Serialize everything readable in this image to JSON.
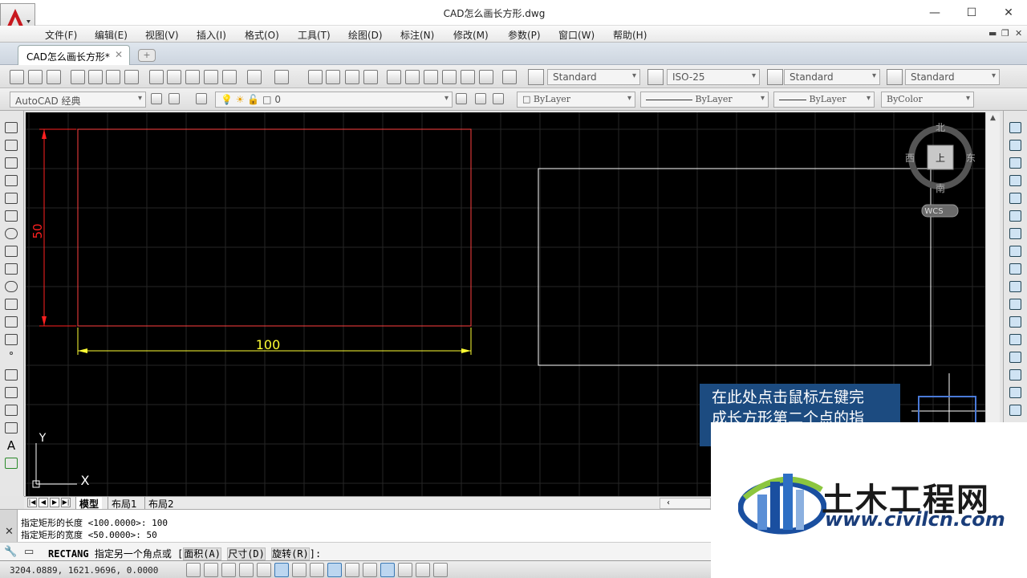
{
  "window": {
    "title": "CAD怎么画长方形.dwg",
    "min_glyph": "—",
    "max_glyph": "☐",
    "close_glyph": "✕"
  },
  "menu": {
    "items": [
      "文件(F)",
      "编辑(E)",
      "视图(V)",
      "插入(I)",
      "格式(O)",
      "工具(T)",
      "绘图(D)",
      "标注(N)",
      "修改(M)",
      "参数(P)",
      "窗口(W)",
      "帮助(H)"
    ]
  },
  "tab": {
    "label": "CAD怎么画长方形*",
    "close": "✕",
    "new": "+"
  },
  "styles": {
    "text_style": "Standard",
    "dim_style": "ISO-25",
    "table_style": "Standard",
    "mleader_style": "Standard"
  },
  "toolbar2": {
    "workspace": "AutoCAD 经典",
    "layer": "0",
    "color": "ByLayer",
    "linetype": "ByLayer",
    "lineweight": "ByLayer",
    "plotstyle": "ByColor"
  },
  "viewcube": {
    "north": "北",
    "south": "南",
    "west": "西",
    "east": "东",
    "face": "上",
    "wcs": "WCS"
  },
  "drawing": {
    "dim_horizontal": "100",
    "dim_vertical": "50",
    "ucs_y": "Y",
    "ucs_x": "X",
    "colors": {
      "red": "#ff2020",
      "yellow": "#ffff33",
      "white": "#ffffff",
      "grid": "#262626"
    }
  },
  "layout_tabs": [
    "模型",
    "布局1",
    "布局2"
  ],
  "command": {
    "history1": "指定矩形的长度 <100.0000>: 100",
    "history2": "指定矩形的宽度 <50.0000>: 50",
    "prompt_cmd": "RECTANG",
    "prompt_text": "指定另一个角点或 [",
    "opt1": "面积(A)",
    "opt2": "尺寸(D)",
    "opt3": "旋转(R)",
    "prompt_end": "]:"
  },
  "status": {
    "coords": "3204.0889, 1621.9696, 0.0000"
  },
  "tooltip": {
    "line1": "在此处点击鼠标左键完",
    "line2": "成长方形第二个点的指"
  },
  "watermark": {
    "title": "土木工程网",
    "url": "www.civilcn.com"
  }
}
